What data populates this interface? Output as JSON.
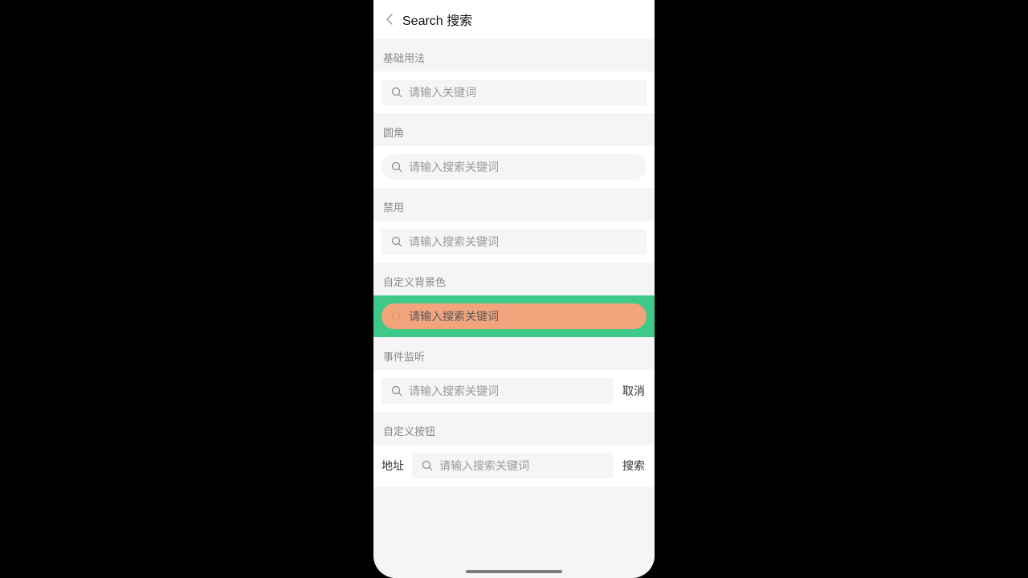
{
  "nav": {
    "title": "Search 搜索"
  },
  "sections": {
    "basic": {
      "label": "基础用法",
      "placeholder": "请输入关键词"
    },
    "rounded": {
      "label": "圆角",
      "placeholder": "请输入搜索关键词"
    },
    "disabled": {
      "label": "禁用",
      "placeholder": "请输入搜索关键词"
    },
    "customBg": {
      "label": "自定义背景色",
      "placeholder": "请输入搜索关键词"
    },
    "events": {
      "label": "事件监听",
      "placeholder": "请输入搜索关键词",
      "action": "取消"
    },
    "customBtn": {
      "label": "自定义按钮",
      "prefix": "地址",
      "placeholder": "请输入搜索关键词",
      "action": "搜索"
    }
  }
}
